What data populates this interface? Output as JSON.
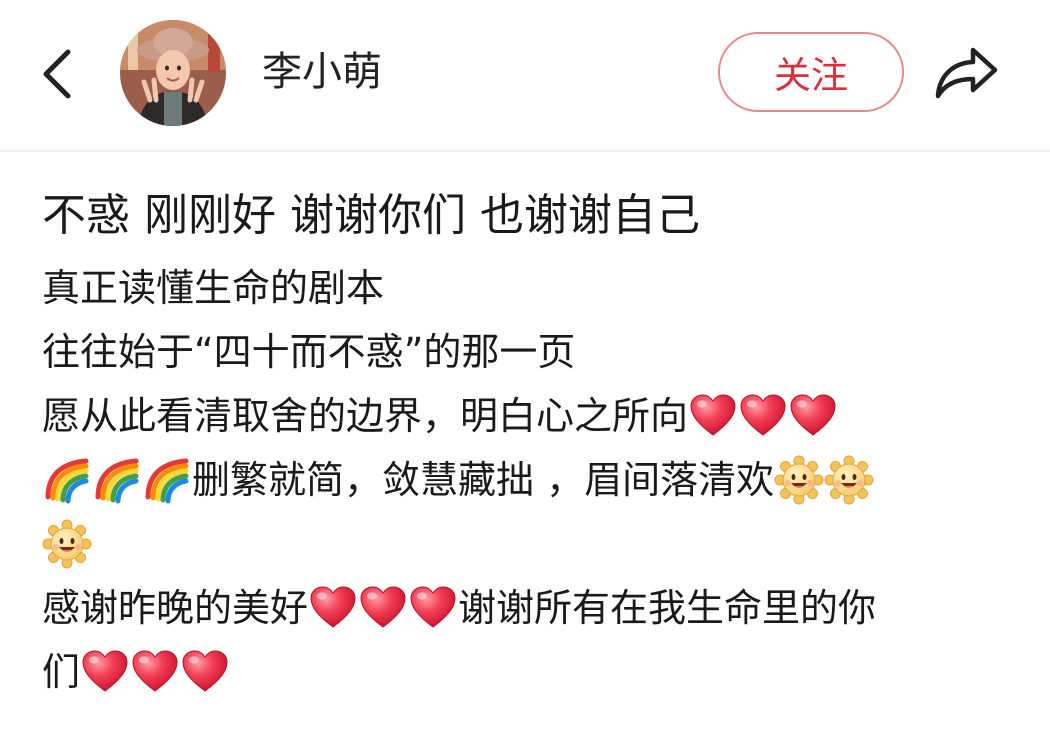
{
  "header": {
    "back_icon": "chevron-left-icon",
    "username": "李小萌",
    "follow_label": "关注",
    "share_icon": "share-arrow-icon",
    "colors": {
      "follow_text": "#d9303c",
      "follow_border": "#e4898e"
    }
  },
  "post": {
    "title": "不惑 刚刚好 谢谢你们 也谢谢自己",
    "lines": [
      {
        "t1": "真正读懂生命的剧本"
      },
      {
        "t1": "往往始于“四十而不惑”的那一页"
      },
      {
        "t1": "愿从此看清取舍的边界，明白心之所向",
        "emoji_after": [
          "heart-emoji",
          "heart-emoji",
          "heart-emoji"
        ]
      },
      {
        "emoji_before": [
          "rainbow-emoji",
          "rainbow-emoji",
          "rainbow-emoji"
        ],
        "t1": "删繁就简，敛慧藏拙 ，眉间落清欢",
        "emoji_after": [
          "sun-emoji",
          "sun-emoji"
        ]
      },
      {
        "emoji_before": [
          "sun-emoji"
        ]
      },
      {
        "t1": "感谢昨晚的美好",
        "emoji_mid": [
          "heart-emoji",
          "heart-emoji",
          "heart-emoji"
        ],
        "t2": "谢谢所有在我生命里的你"
      },
      {
        "t1": "们",
        "emoji_after": [
          "heart-emoji",
          "heart-emoji",
          "heart-emoji"
        ]
      }
    ]
  }
}
